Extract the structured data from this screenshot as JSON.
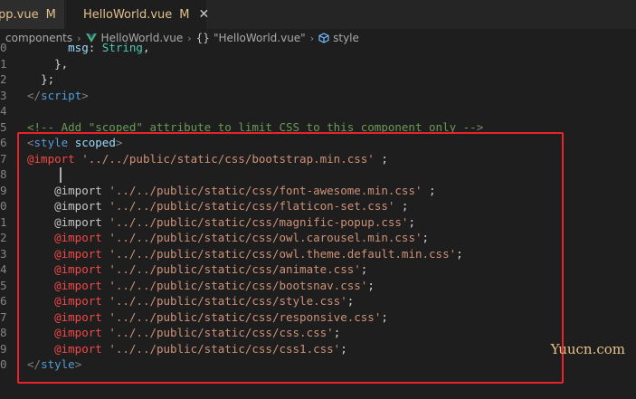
{
  "tabs": [
    {
      "name": "pp.vue",
      "status": "M"
    },
    {
      "name": "HelloWorld.vue",
      "status": "M",
      "close": "✕"
    }
  ],
  "breadcrumb": {
    "items": [
      "components",
      "HelloWorld.vue",
      "\"HelloWorld.vue\"",
      "style"
    ],
    "braces": "{}",
    "separator": "›"
  },
  "editor": {
    "lines": [
      {
        "num": "0",
        "tokens": [
          [
            "",
            "      "
          ],
          [
            "c-prop",
            "msg"
          ],
          [
            "c-punc",
            ": "
          ],
          [
            "c-id",
            "String"
          ],
          [
            "c-punc",
            ","
          ]
        ]
      },
      {
        "num": "1",
        "tokens": [
          [
            "",
            "    "
          ],
          [
            "c-punc",
            "},"
          ]
        ]
      },
      {
        "num": "2",
        "tokens": [
          [
            "",
            "  "
          ],
          [
            "c-punc",
            "};"
          ]
        ]
      },
      {
        "num": "3",
        "tokens": [
          [
            "c-bracket",
            "</"
          ],
          [
            "c-tag",
            "script"
          ],
          [
            "c-bracket",
            ">"
          ]
        ]
      },
      {
        "num": "4",
        "tokens": []
      },
      {
        "num": "5",
        "tokens": [
          [
            "c-comment",
            "<!-- Add \"scoped\" attribute to limit CSS to this component only -->"
          ]
        ]
      },
      {
        "num": "6",
        "tokens": [
          [
            "c-bracket",
            "<"
          ],
          [
            "c-tag",
            "style"
          ],
          [
            "c-punc",
            " "
          ],
          [
            "c-attr",
            "scoped"
          ],
          [
            "c-bracket",
            ">"
          ]
        ]
      },
      {
        "num": "7",
        "tokens": [
          [
            "c-kw-red",
            "@import"
          ],
          [
            "c-punc",
            " "
          ],
          [
            "c-path",
            "'../../public/static/css/bootstrap.min.css'"
          ],
          [
            "c-punc",
            " ;"
          ]
        ]
      },
      {
        "num": "8",
        "tokens": []
      },
      {
        "num": "9",
        "tokens": [
          [
            "",
            "    "
          ],
          [
            "c-kw",
            "@import"
          ],
          [
            "c-punc",
            " "
          ],
          [
            "c-path",
            "'../../public/static/css/font-awesome.min.css'"
          ],
          [
            "c-punc",
            " ;"
          ]
        ]
      },
      {
        "num": "0",
        "tokens": [
          [
            "",
            "    "
          ],
          [
            "c-kw",
            "@import"
          ],
          [
            "c-punc",
            " "
          ],
          [
            "c-path",
            "'../../public/static/css/flaticon-set.css'"
          ],
          [
            "c-punc",
            " ;"
          ]
        ]
      },
      {
        "num": "1",
        "tokens": [
          [
            "",
            "    "
          ],
          [
            "c-kw",
            "@import"
          ],
          [
            "c-punc",
            " "
          ],
          [
            "c-path",
            "'../../public/static/css/magnific-popup.css'"
          ],
          [
            "c-punc",
            ";"
          ]
        ]
      },
      {
        "num": "2",
        "tokens": [
          [
            "",
            "    "
          ],
          [
            "c-kw-red",
            "@import"
          ],
          [
            "c-punc",
            " "
          ],
          [
            "c-path",
            "'../../public/static/css/owl.carousel.min.css'"
          ],
          [
            "c-punc",
            ";"
          ]
        ]
      },
      {
        "num": "3",
        "tokens": [
          [
            "",
            "    "
          ],
          [
            "c-kw-red",
            "@import"
          ],
          [
            "c-punc",
            " "
          ],
          [
            "c-path",
            "'../../public/static/css/owl.theme.default.min.css'"
          ],
          [
            "c-punc",
            ";"
          ]
        ]
      },
      {
        "num": "4",
        "tokens": [
          [
            "",
            "    "
          ],
          [
            "c-kw-red",
            "@import"
          ],
          [
            "c-punc",
            " "
          ],
          [
            "c-path",
            "'../../public/static/css/animate.css'"
          ],
          [
            "c-punc",
            ";"
          ]
        ]
      },
      {
        "num": "5",
        "tokens": [
          [
            "",
            "    "
          ],
          [
            "c-kw-red",
            "@import"
          ],
          [
            "c-punc",
            " "
          ],
          [
            "c-path",
            "'../../public/static/css/bootsnav.css'"
          ],
          [
            "c-punc",
            ";"
          ]
        ]
      },
      {
        "num": "6",
        "tokens": [
          [
            "",
            "    "
          ],
          [
            "c-kw-red",
            "@import"
          ],
          [
            "c-punc",
            " "
          ],
          [
            "c-path",
            "'../../public/static/css/style.css'"
          ],
          [
            "c-punc",
            ";"
          ]
        ]
      },
      {
        "num": "7",
        "tokens": [
          [
            "",
            "    "
          ],
          [
            "c-kw-red",
            "@import"
          ],
          [
            "c-punc",
            " "
          ],
          [
            "c-path",
            "'../../public/static/css/responsive.css'"
          ],
          [
            "c-punc",
            ";"
          ]
        ]
      },
      {
        "num": "8",
        "tokens": [
          [
            "",
            "    "
          ],
          [
            "c-kw-red",
            "@import"
          ],
          [
            "c-punc",
            " "
          ],
          [
            "c-path",
            "'../../public/static/css/css.css'"
          ],
          [
            "c-punc",
            ";"
          ]
        ]
      },
      {
        "num": "9",
        "tokens": [
          [
            "",
            "    "
          ],
          [
            "c-kw-red",
            "@import"
          ],
          [
            "c-punc",
            " "
          ],
          [
            "c-path",
            "'../../public/static/css/css1.css'"
          ],
          [
            "c-punc",
            ";"
          ]
        ]
      },
      {
        "num": "0",
        "tokens": [
          [
            "c-bracket",
            "</"
          ],
          [
            "c-tag",
            "style"
          ],
          [
            "c-bracket",
            ">"
          ]
        ]
      }
    ]
  },
  "watermark": "Yuucn.com",
  "colors": {
    "background": "#1e1e1e",
    "highlight_box": "#e8242a",
    "modified": "#e2c08d",
    "vue_green": "#41b883"
  }
}
